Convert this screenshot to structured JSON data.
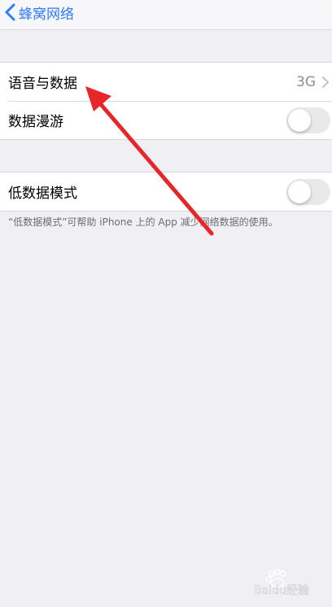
{
  "nav": {
    "back_label": "蜂窝网络"
  },
  "group1": {
    "voice_data": {
      "label": "语音与数据",
      "value": "3G"
    },
    "roaming": {
      "label": "数据漫游",
      "toggle_on": false
    }
  },
  "group2": {
    "low_data_mode": {
      "label": "低数据模式",
      "toggle_on": false
    }
  },
  "footnote": "“低数据模式”可帮助 iPhone 上的 App 减少网络数据的使用。",
  "watermark": {
    "text": "Baidu经验"
  },
  "colors": {
    "background": "#efeff4",
    "accent": "#2e7cf6",
    "annotation_arrow": "#e8262a"
  }
}
